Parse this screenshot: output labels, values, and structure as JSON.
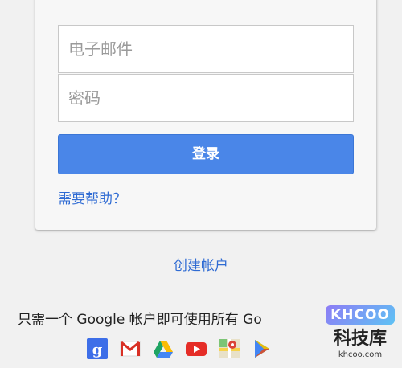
{
  "login": {
    "email_placeholder": "电子邮件",
    "password_placeholder": "密码",
    "login_button": "登录",
    "help_link": "需要帮助？"
  },
  "create_account_link": "创建帐户",
  "tagline": "只需一个 Google 帐户即可使用所有 Go",
  "app_icons": [
    "google-plus-icon",
    "gmail-icon",
    "drive-icon",
    "youtube-icon",
    "maps-icon",
    "play-store-icon"
  ],
  "watermark": {
    "logo": "KHCOO",
    "chinese": "科技库",
    "url": "khcoo.com"
  },
  "colors": {
    "accent_blue": "#4a86e8",
    "link_blue": "#2f6bd3",
    "background": "#f1f1f1"
  }
}
